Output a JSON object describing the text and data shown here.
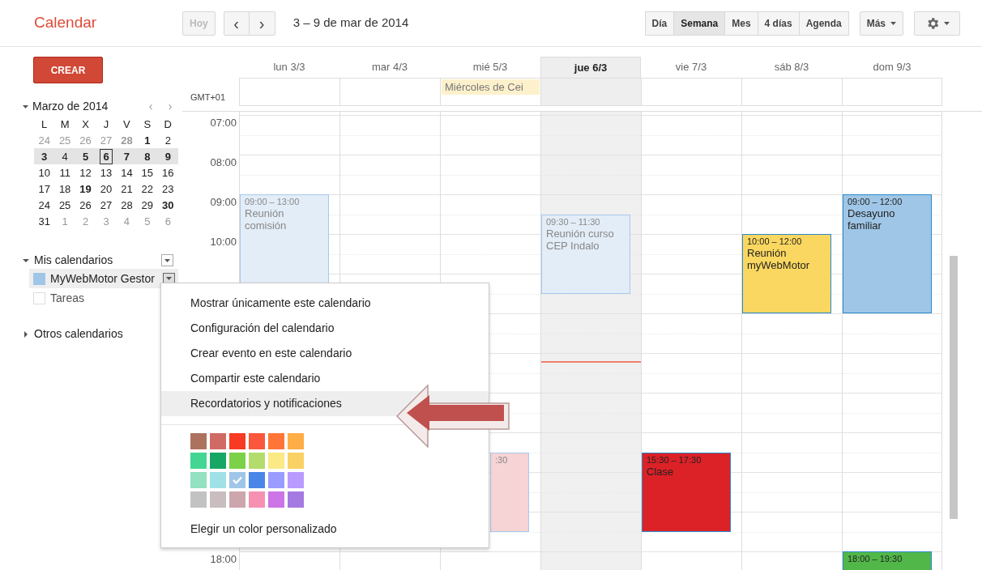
{
  "app_title": "Calendar",
  "create_button": "CREAR",
  "toolbar": {
    "today": {
      "label": "Hoy",
      "disabled": true
    },
    "prev": "‹",
    "next": "›",
    "date_range": "3 – 9 de mar de 2014",
    "views": [
      {
        "label": "Día",
        "selected": false
      },
      {
        "label": "Semana",
        "selected": true
      },
      {
        "label": "Mes",
        "selected": false
      },
      {
        "label": "4 días",
        "selected": false
      },
      {
        "label": "Agenda",
        "selected": false
      }
    ],
    "more": "Más"
  },
  "mini_calendar": {
    "title": "Marzo de 2014",
    "prev": "‹",
    "next": "›",
    "weekdays": [
      "L",
      "M",
      "X",
      "J",
      "V",
      "S",
      "D"
    ],
    "weeks": [
      {
        "selected": false,
        "days": [
          {
            "n": "24",
            "muted": true,
            "bold": false,
            "today": false
          },
          {
            "n": "25",
            "muted": true,
            "bold": false,
            "today": false
          },
          {
            "n": "26",
            "muted": true,
            "bold": false,
            "today": false
          },
          {
            "n": "27",
            "muted": true,
            "bold": false,
            "today": false
          },
          {
            "n": "28",
            "muted": true,
            "bold": true,
            "today": false
          },
          {
            "n": "1",
            "muted": false,
            "bold": true,
            "today": false
          },
          {
            "n": "2",
            "muted": false,
            "bold": false,
            "today": false
          }
        ]
      },
      {
        "selected": true,
        "days": [
          {
            "n": "3",
            "muted": false,
            "bold": true,
            "today": false
          },
          {
            "n": "4",
            "muted": false,
            "bold": false,
            "today": false
          },
          {
            "n": "5",
            "muted": false,
            "bold": true,
            "today": false
          },
          {
            "n": "6",
            "muted": false,
            "bold": true,
            "today": true
          },
          {
            "n": "7",
            "muted": false,
            "bold": true,
            "today": false
          },
          {
            "n": "8",
            "muted": false,
            "bold": true,
            "today": false
          },
          {
            "n": "9",
            "muted": false,
            "bold": true,
            "today": false
          }
        ]
      },
      {
        "selected": false,
        "days": [
          {
            "n": "10",
            "muted": false,
            "bold": false,
            "today": false
          },
          {
            "n": "11",
            "muted": false,
            "bold": false,
            "today": false
          },
          {
            "n": "12",
            "muted": false,
            "bold": false,
            "today": false
          },
          {
            "n": "13",
            "muted": false,
            "bold": false,
            "today": false
          },
          {
            "n": "14",
            "muted": false,
            "bold": false,
            "today": false
          },
          {
            "n": "15",
            "muted": false,
            "bold": false,
            "today": false
          },
          {
            "n": "16",
            "muted": false,
            "bold": false,
            "today": false
          }
        ]
      },
      {
        "selected": false,
        "days": [
          {
            "n": "17",
            "muted": false,
            "bold": false,
            "today": false
          },
          {
            "n": "18",
            "muted": false,
            "bold": false,
            "today": false
          },
          {
            "n": "19",
            "muted": false,
            "bold": true,
            "today": false
          },
          {
            "n": "20",
            "muted": false,
            "bold": false,
            "today": false
          },
          {
            "n": "21",
            "muted": false,
            "bold": false,
            "today": false
          },
          {
            "n": "22",
            "muted": false,
            "bold": false,
            "today": false
          },
          {
            "n": "23",
            "muted": false,
            "bold": false,
            "today": false
          }
        ]
      },
      {
        "selected": false,
        "days": [
          {
            "n": "24",
            "muted": false,
            "bold": false,
            "today": false
          },
          {
            "n": "25",
            "muted": false,
            "bold": false,
            "today": false
          },
          {
            "n": "26",
            "muted": false,
            "bold": false,
            "today": false
          },
          {
            "n": "27",
            "muted": false,
            "bold": false,
            "today": false
          },
          {
            "n": "28",
            "muted": false,
            "bold": false,
            "today": false
          },
          {
            "n": "29",
            "muted": false,
            "bold": false,
            "today": false
          },
          {
            "n": "30",
            "muted": false,
            "bold": true,
            "today": false
          }
        ]
      },
      {
        "selected": false,
        "days": [
          {
            "n": "31",
            "muted": false,
            "bold": false,
            "today": false
          },
          {
            "n": "1",
            "muted": true,
            "bold": false,
            "today": false
          },
          {
            "n": "2",
            "muted": true,
            "bold": false,
            "today": false
          },
          {
            "n": "3",
            "muted": true,
            "bold": false,
            "today": false
          },
          {
            "n": "4",
            "muted": true,
            "bold": false,
            "today": false
          },
          {
            "n": "5",
            "muted": true,
            "bold": false,
            "today": false
          },
          {
            "n": "6",
            "muted": true,
            "bold": false,
            "today": false
          }
        ]
      }
    ]
  },
  "my_calendars": {
    "title": "Mis calendarios",
    "expanded": true,
    "items": [
      {
        "name": "MyWebMotor Gestor",
        "checked": true,
        "selected": true,
        "color": "#9fc6e7"
      },
      {
        "name": "Tareas",
        "checked": false,
        "selected": false
      }
    ]
  },
  "other_calendars": {
    "title": "Otros calendarios",
    "expanded": false
  },
  "timezone": "GMT+01",
  "days": [
    {
      "label": "lun 3/3",
      "today": false
    },
    {
      "label": "mar 4/3",
      "today": false
    },
    {
      "label": "mié 5/3",
      "today": false
    },
    {
      "label": "jue 6/3",
      "today": true
    },
    {
      "label": "vie 7/3",
      "today": false
    },
    {
      "label": "sáb 8/3",
      "today": false
    },
    {
      "label": "dom 9/3",
      "today": false
    }
  ],
  "all_day_events": [
    {
      "title": "Miércoles de Cei"
    }
  ],
  "hour_labels": [
    "07:00",
    "08:00",
    "09:00",
    "10:00",
    "18:00"
  ],
  "events": [
    {
      "time": "09:00 – 13:00",
      "title": "Reunión comisión",
      "color": "#e3edf7",
      "past": true
    },
    {
      "time": "09:30 – 11:30",
      "title": "Reunión curso CEP Indalo",
      "color": "#e3edf7",
      "past": true
    },
    {
      "time": "10:00 – 12:00",
      "title": "Reunión myWebMotor",
      "color": "#fad760",
      "past": false
    },
    {
      "time": "09:00 – 12:00",
      "title": "Desayuno familiar",
      "color": "#9fc6e7",
      "past": false
    },
    {
      "time": ":30",
      "color": "#f6d3d4",
      "past": true
    },
    {
      "time": "15:30 – 17:30",
      "title": "Clase",
      "color": "#dc2127",
      "past": false
    },
    {
      "time": "18:00 – 19:30",
      "color": "#51b749",
      "past": false
    }
  ],
  "context_menu": {
    "items": [
      {
        "label": "Mostrar únicamente este calendario",
        "selected": false
      },
      {
        "label": "Configuración del calendario",
        "selected": false
      },
      {
        "label": "Crear evento en este calendario",
        "selected": false
      },
      {
        "label": "Compartir este calendario",
        "selected": false
      },
      {
        "label": "Recordatorios y notificaciones",
        "selected": true
      }
    ],
    "swatches": [
      {
        "color": "#ac725e",
        "selected": false
      },
      {
        "color": "#d06b64",
        "selected": false
      },
      {
        "color": "#f83a22",
        "selected": false
      },
      {
        "color": "#fa573c",
        "selected": false
      },
      {
        "color": "#ff7537",
        "selected": false
      },
      {
        "color": "#ffad46",
        "selected": false
      },
      {
        "color": "#42d692",
        "selected": false
      },
      {
        "color": "#16a765",
        "selected": false
      },
      {
        "color": "#7bd148",
        "selected": false
      },
      {
        "color": "#b3dc6c",
        "selected": false
      },
      {
        "color": "#fbe983",
        "selected": false
      },
      {
        "color": "#fad165",
        "selected": false
      },
      {
        "color": "#92e1c0",
        "selected": false
      },
      {
        "color": "#9fe1e7",
        "selected": false
      },
      {
        "color": "#9fc6e7",
        "selected": true
      },
      {
        "color": "#4986e7",
        "selected": false
      },
      {
        "color": "#9a9cff",
        "selected": false
      },
      {
        "color": "#b99aff",
        "selected": false
      },
      {
        "color": "#c2c2c2",
        "selected": false
      },
      {
        "color": "#cabdbf",
        "selected": false
      },
      {
        "color": "#cca6ac",
        "selected": false
      },
      {
        "color": "#f691b2",
        "selected": false
      },
      {
        "color": "#cd74e6",
        "selected": false
      },
      {
        "color": "#a47ae2",
        "selected": false
      }
    ],
    "custom_color": "Elegir un color personalizado"
  }
}
